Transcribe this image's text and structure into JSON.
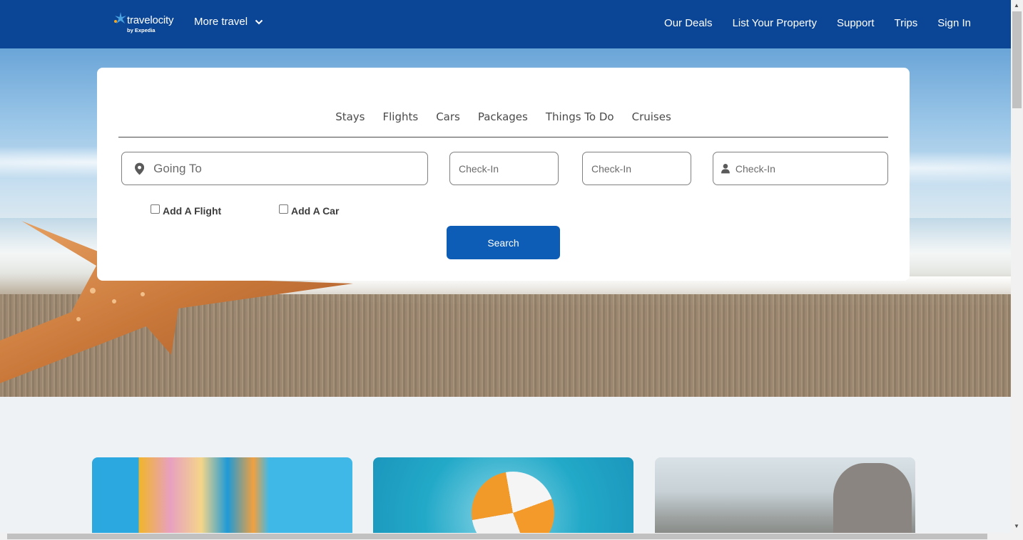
{
  "header": {
    "logo_text": "travelocity",
    "logo_byline": "by Expedia",
    "more_travel_label": "More travel",
    "nav": [
      "Our Deals",
      "List Your Property",
      "Support",
      "Trips",
      "Sign In"
    ]
  },
  "search": {
    "tabs": [
      "Stays",
      "Flights",
      "Cars",
      "Packages",
      "Things To Do",
      "Cruises"
    ],
    "going_to_placeholder": "Going To",
    "checkin_placeholder_1": "Check-In",
    "checkin_placeholder_2": "Check-In",
    "travelers_placeholder": "Check-In",
    "add_flight_label": "Add A Flight",
    "add_car_label": "Add A Car",
    "search_button_label": "Search"
  },
  "colors": {
    "header_bg": "#0b4596",
    "button_bg": "#0d5cb6",
    "page_bg": "#eff2f5"
  },
  "icons": [
    "travelocity-star-logo",
    "chevron-down-icon",
    "map-pin-icon",
    "person-icon"
  ]
}
